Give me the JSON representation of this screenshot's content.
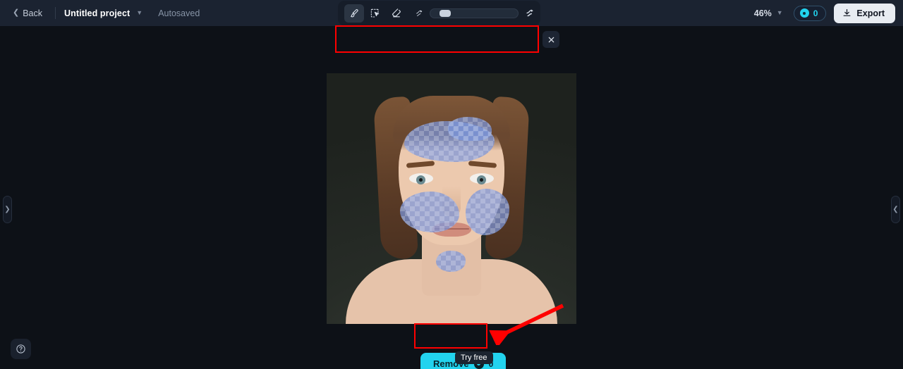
{
  "header": {
    "back_label": "Back",
    "back_icon": "chevron-left-icon",
    "project_title": "Untitled project",
    "project_caret_icon": "chevron-down-icon",
    "autosaved_label": "Autosaved",
    "center_tools": [
      {
        "name": "hand-tool",
        "icon": "hand-icon",
        "disabled": false
      },
      {
        "name": "undo",
        "icon": "undo-icon",
        "disabled": false
      },
      {
        "name": "redo",
        "icon": "redo-icon",
        "disabled": true
      },
      {
        "name": "reset",
        "icon": "refresh-icon",
        "disabled": false
      }
    ],
    "zoom_level": "46%",
    "zoom_caret_icon": "chevron-down-icon",
    "credits_count": "0",
    "credits_icon": "credit-coin-icon",
    "export_label": "Export",
    "export_icon": "download-icon"
  },
  "toolbar": {
    "tools": [
      {
        "name": "brush-tool",
        "icon": "brush-icon",
        "active": true
      },
      {
        "name": "object-select-tool",
        "icon": "cursor-select-icon",
        "active": false
      },
      {
        "name": "eraser-tool",
        "icon": "eraser-icon",
        "active": false
      }
    ],
    "brush_size_small_icon": "brush-size-small-icon",
    "brush_size_large_icon": "brush-size-large-icon",
    "brush_size_percent": 10,
    "close_icon": "close-icon"
  },
  "canvas": {
    "image_alt": "portrait-photo",
    "mask_color": "#7b96db",
    "background_color": "#0d1117",
    "mask_patches": [
      {
        "name": "mask-forehead"
      },
      {
        "name": "mask-forehead-upper"
      },
      {
        "name": "mask-cheek-left"
      },
      {
        "name": "mask-cheek-right"
      },
      {
        "name": "mask-chin"
      }
    ]
  },
  "panels": {
    "left_handle_icon": "chevron-right-icon",
    "right_handle_icon": "chevron-left-icon"
  },
  "actions": {
    "remove_label": "Remove",
    "remove_cost": "0",
    "remove_cost_icon": "credit-coin-icon",
    "tooltip_label": "Try free",
    "accent_color": "#22d3ee"
  },
  "help": {
    "icon": "question-mark-icon"
  },
  "annotations": {
    "highlight_color": "#ff0000",
    "arrow_icon": "arrow-down-left-icon"
  }
}
